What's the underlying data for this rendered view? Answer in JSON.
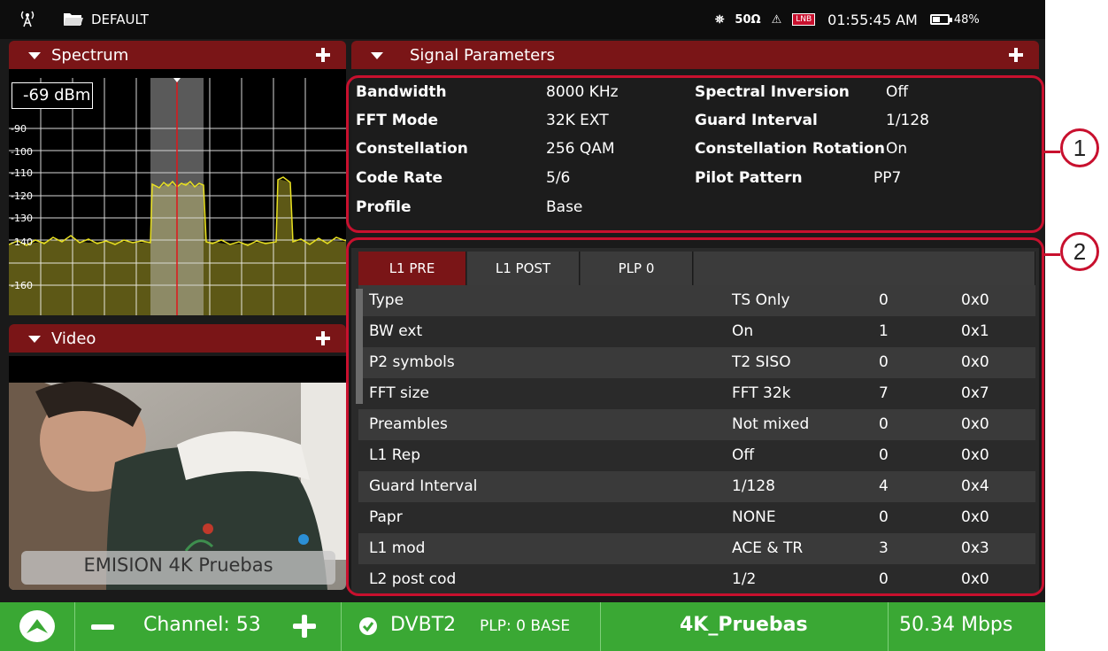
{
  "status_bar": {
    "profile": "DEFAULT",
    "impedance": "50Ω",
    "lnb_badge": "LNB",
    "time": "01:55:45 AM",
    "battery_percent": "48%",
    "battery_level": 0.48,
    "icons": [
      "antenna-icon",
      "folder-icon",
      "satellite-icon",
      "warning-icon",
      "lnb-icon",
      "battery-icon"
    ]
  },
  "spectrum": {
    "title": "Spectrum",
    "level_readout": "-69 dBm",
    "tick_labels": [
      "-90",
      "-100",
      "-110",
      "-120",
      "-130",
      "-140",
      "-160"
    ]
  },
  "video": {
    "title": "Video",
    "caption": "EMISION 4K Pruebas"
  },
  "signal_parameters": {
    "title": "Signal Parameters",
    "left": [
      {
        "label": "Bandwidth",
        "value": "8000 KHz"
      },
      {
        "label": "FFT Mode",
        "value": "32K EXT"
      },
      {
        "label": "Constellation",
        "value": "256 QAM"
      },
      {
        "label": "Code Rate",
        "value": "5/6"
      },
      {
        "label": "Profile",
        "value": "Base"
      }
    ],
    "right": [
      {
        "label": "Spectral Inversion",
        "value": "Off"
      },
      {
        "label": "Guard Interval",
        "value": "1/128"
      },
      {
        "label": "Constellation Rotation",
        "value": "On"
      },
      {
        "label": "Pilot Pattern",
        "value": "PP7"
      }
    ]
  },
  "l1_table": {
    "tabs": [
      "L1 PRE",
      "L1 POST",
      "PLP 0"
    ],
    "active_tab": 0,
    "rows": [
      {
        "name": "Type",
        "value": "TS Only",
        "dec": "0",
        "hex": "0x0"
      },
      {
        "name": "BW ext",
        "value": "On",
        "dec": "1",
        "hex": "0x1"
      },
      {
        "name": "P2 symbols",
        "value": "T2 SISO",
        "dec": "0",
        "hex": "0x0"
      },
      {
        "name": "FFT size",
        "value": "FFT 32k",
        "dec": "7",
        "hex": "0x7"
      },
      {
        "name": "Preambles",
        "value": "Not mixed",
        "dec": "0",
        "hex": "0x0"
      },
      {
        "name": "L1 Rep",
        "value": "Off",
        "dec": "0",
        "hex": "0x0"
      },
      {
        "name": "Guard Interval",
        "value": "1/128",
        "dec": "4",
        "hex": "0x4"
      },
      {
        "name": "Papr",
        "value": "NONE",
        "dec": "0",
        "hex": "0x0"
      },
      {
        "name": "L1 mod",
        "value": "ACE & TR",
        "dec": "3",
        "hex": "0x3"
      },
      {
        "name": "L2 post cod",
        "value": "1/2",
        "dec": "0",
        "hex": "0x0"
      }
    ]
  },
  "callouts": [
    "1",
    "2"
  ],
  "bottom_bar": {
    "channel": "Channel: 53",
    "standard": "DVBT2",
    "plp": "PLP: 0 BASE",
    "service": "4K_Pruebas",
    "bitrate": "50.34 Mbps"
  },
  "colors": {
    "header_red": "#7a1517",
    "accent_red": "#c8102e",
    "bottom_green": "#3aa834",
    "trace_yellow": "#d9d21a"
  }
}
